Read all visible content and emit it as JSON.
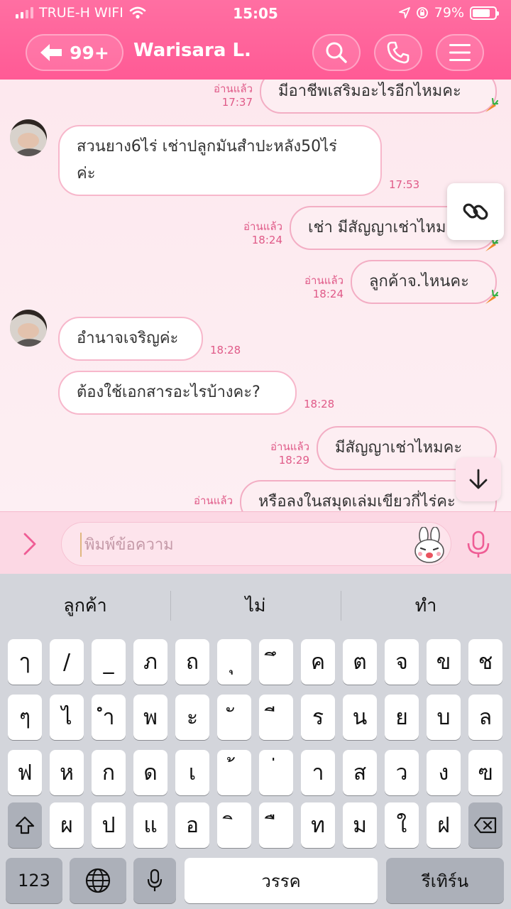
{
  "status_bar": {
    "carrier": "TRUE-H WIFI",
    "time": "15:05",
    "battery": "79%",
    "battery_level": 0.79
  },
  "header": {
    "back_count": "99+",
    "chat_name": "Warisara L.",
    "icons": [
      "search-icon",
      "phone-icon",
      "menu-icon"
    ]
  },
  "messages": {
    "m1": {
      "read": "อ่านแล้ว",
      "time": "17:37",
      "lines": [
        "มีอาชีพเสริมอะไรอีกไหมคะ"
      ]
    },
    "m2": {
      "time": "17:53",
      "lines": [
        "สวนยาง6ไร่ เช่าปลูกมันสำปะหลัง50ไร่",
        "ค่ะ"
      ]
    },
    "m3": {
      "read": "อ่านแล้ว",
      "time": "18:24",
      "lines": [
        "เช่า มีสัญญาเช่าไหมคะ"
      ]
    },
    "m4": {
      "read": "อ่านแล้ว",
      "time": "18:24",
      "lines": [
        "ลูกค้าจ.ไหนคะ"
      ]
    },
    "m5": {
      "time": "18:28",
      "lines": [
        "อำนาจเจริญค่ะ"
      ]
    },
    "m6": {
      "time": "18:28",
      "lines": [
        "ต้องใช้เอกสารอะไรบ้างคะ?"
      ]
    },
    "m7": {
      "read": "อ่านแล้ว",
      "time": "18:29",
      "lines": [
        "มีสัญญาเช่าไหมคะ"
      ]
    },
    "m8": {
      "read": "อ่านแล้ว",
      "lines": [
        "หรือลงในสมุดเล่มเขียวกี่ไร่คะ"
      ]
    }
  },
  "input": {
    "placeholder": "พิมพ์ข้อความ"
  },
  "keyboard": {
    "suggestions": [
      "ลูกค้า",
      "ไม่",
      "ทำ"
    ],
    "row1": [
      "ๅ",
      "/",
      "_",
      "ภ",
      "ถ",
      "ุ",
      "ึ",
      "ค",
      "ต",
      "จ",
      "ข",
      "ช"
    ],
    "row2": [
      "ๆ",
      "ไ",
      "ำ",
      "พ",
      "ะ",
      "ั",
      "ี",
      "ร",
      "น",
      "ย",
      "บ",
      "ล"
    ],
    "row3": [
      "ฟ",
      "ห",
      "ก",
      "ด",
      "เ",
      "้",
      "่",
      "า",
      "ส",
      "ว",
      "ง",
      "ฃ"
    ],
    "row4": [
      "ผ",
      "ป",
      "แ",
      "อ",
      "ิ",
      "ื",
      "ท",
      "ม",
      "ใ",
      "ฝ"
    ],
    "numbers_key": "123",
    "space_key": "วรรค",
    "return_key": "รีเทิร์น"
  }
}
